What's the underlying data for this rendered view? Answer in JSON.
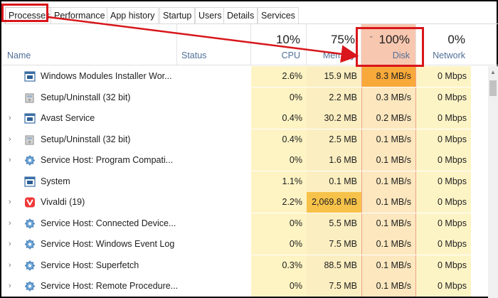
{
  "tabs": [
    {
      "label": "Processes",
      "active": true
    },
    {
      "label": "Performance"
    },
    {
      "label": "App history"
    },
    {
      "label": "Startup"
    },
    {
      "label": "Users"
    },
    {
      "label": "Details"
    },
    {
      "label": "Services"
    }
  ],
  "header": {
    "name": "Name",
    "status": "Status",
    "cpu": {
      "pct": "10%",
      "label": "CPU"
    },
    "memory": {
      "pct": "75%",
      "label": "Memory"
    },
    "disk": {
      "pct": "100%",
      "label": "Disk",
      "sort_indicator": "chevron-down-icon"
    },
    "network": {
      "pct": "0%",
      "label": "Network"
    }
  },
  "processes": [
    {
      "name": "Windows Modules Installer Wor...",
      "expandable": false,
      "icon": "window-icon",
      "cpu": "2.6%",
      "memory": "15.9 MB",
      "disk": "8.3 MB/s",
      "network": "0 Mbps"
    },
    {
      "name": "Setup/Uninstall (32 bit)",
      "expandable": false,
      "icon": "installer-icon",
      "cpu": "0%",
      "memory": "2.2 MB",
      "disk": "0.3 MB/s",
      "network": "0 Mbps"
    },
    {
      "name": "Avast Service",
      "expandable": true,
      "icon": "window-icon",
      "cpu": "0.4%",
      "memory": "30.2 MB",
      "disk": "0.2 MB/s",
      "network": "0 Mbps"
    },
    {
      "name": "Setup/Uninstall (32 bit)",
      "expandable": true,
      "icon": "installer-icon",
      "cpu": "0.4%",
      "memory": "2.5 MB",
      "disk": "0.1 MB/s",
      "network": "0 Mbps"
    },
    {
      "name": "Service Host: Program Compati...",
      "expandable": true,
      "icon": "gear-icon",
      "cpu": "0%",
      "memory": "1.6 MB",
      "disk": "0.1 MB/s",
      "network": "0 Mbps"
    },
    {
      "name": "System",
      "expandable": false,
      "icon": "window-icon",
      "cpu": "1.1%",
      "memory": "0.1 MB",
      "disk": "0.1 MB/s",
      "network": "0 Mbps"
    },
    {
      "name": "Vivaldi (19)",
      "expandable": true,
      "icon": "vivaldi-icon",
      "cpu": "2.2%",
      "memory": "2,069.8 MB",
      "disk": "0.1 MB/s",
      "network": "0 Mbps"
    },
    {
      "name": "Service Host: Connected Device...",
      "expandable": true,
      "icon": "gear-icon",
      "cpu": "0%",
      "memory": "5.5 MB",
      "disk": "0.1 MB/s",
      "network": "0 Mbps"
    },
    {
      "name": "Service Host: Windows Event Log",
      "expandable": true,
      "icon": "gear-icon",
      "cpu": "0%",
      "memory": "7.5 MB",
      "disk": "0.1 MB/s",
      "network": "0 Mbps"
    },
    {
      "name": "Service Host: Superfetch",
      "expandable": true,
      "icon": "gear-icon",
      "cpu": "0.3%",
      "memory": "88.5 MB",
      "disk": "0.1 MB/s",
      "network": "0 Mbps"
    },
    {
      "name": "Service Host: Remote Procedure...",
      "expandable": true,
      "icon": "gear-icon",
      "cpu": "0%",
      "memory": "7.5 MB",
      "disk": "0.1 MB/s",
      "network": "0 Mbps"
    }
  ],
  "colors": {
    "cpu_bg": "#fdf3c3",
    "memory_bg": "#fbeec0",
    "memory_bg_high": "#f7c24a",
    "disk_bg": "#fce7be",
    "disk_bg_high": "#f9a93a",
    "network_bg": "#fdf4c6",
    "disk_header_bg": "#f8c7b0",
    "annotation_red": "#d8161b"
  }
}
